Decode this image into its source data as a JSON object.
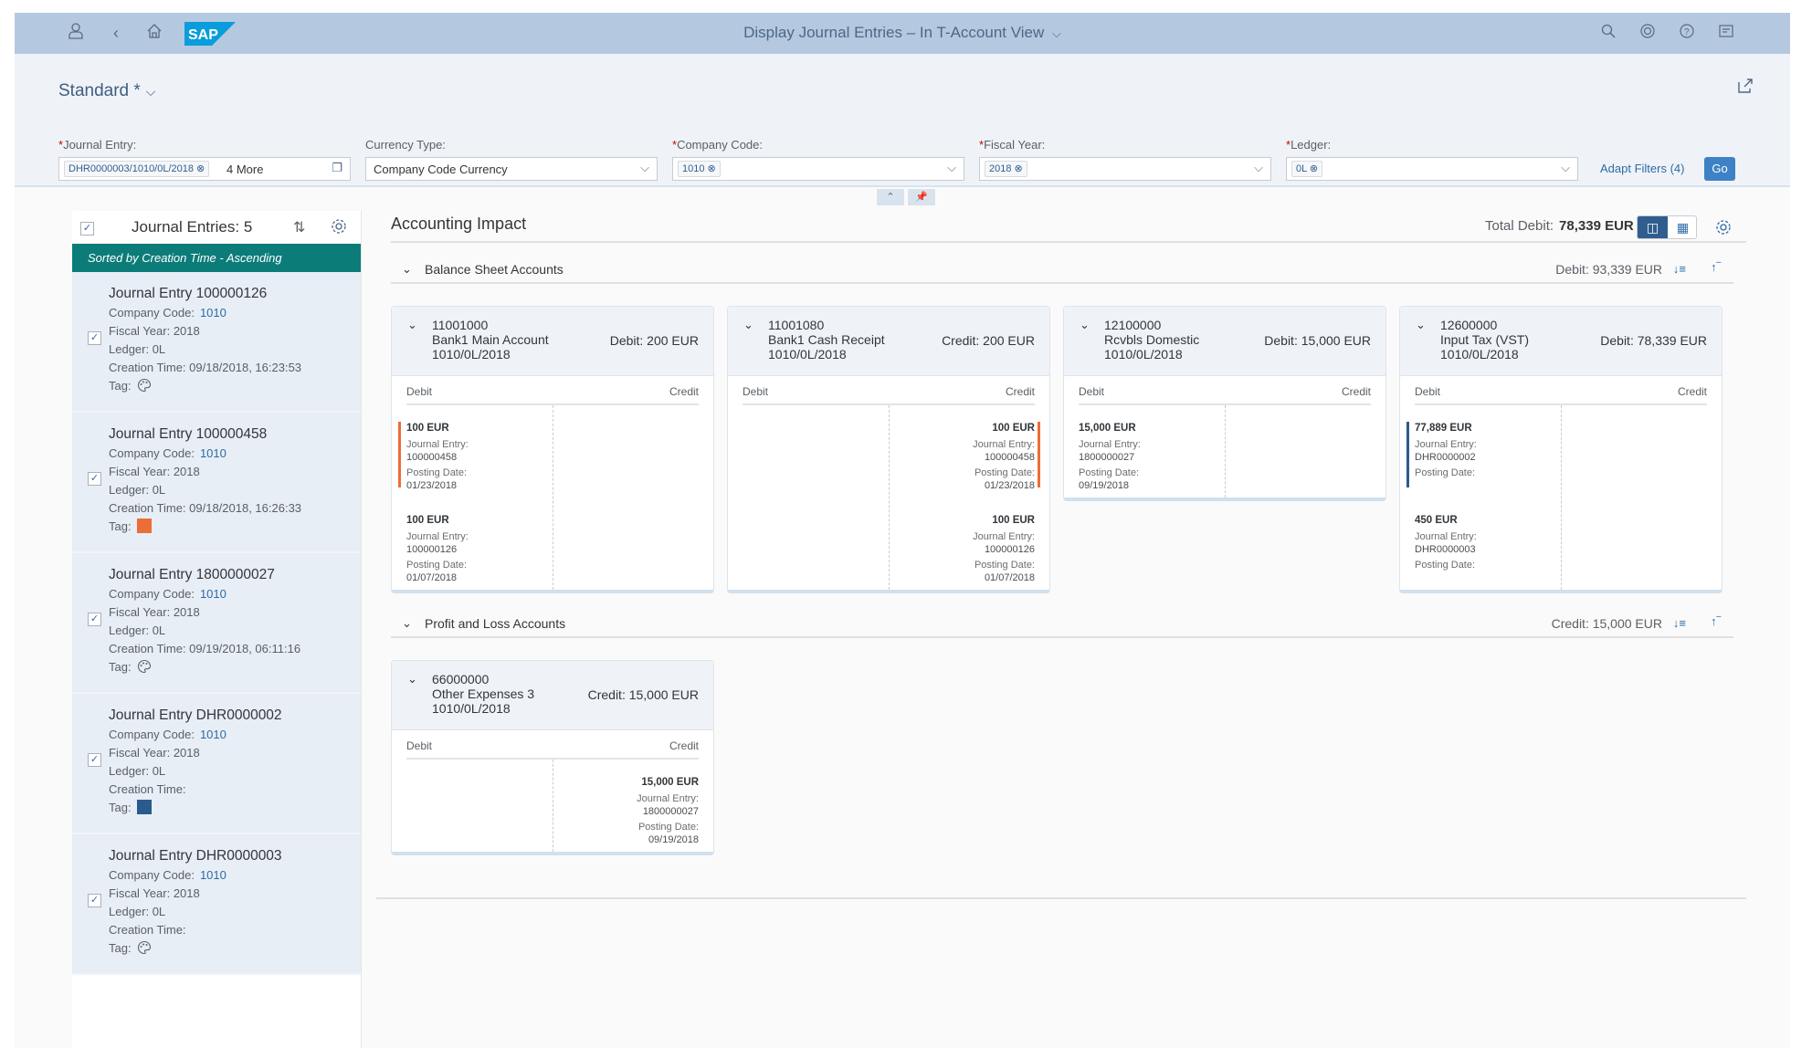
{
  "shell": {
    "title": "Display Journal Entries – In T-Account View",
    "title_chevron": "⌵",
    "logo_text": "SAP",
    "icons": [
      "user-icon",
      "back-icon",
      "home-icon",
      "search-icon",
      "copilot-icon",
      "help-icon",
      "notifications-icon"
    ],
    "brand_color": "#0a9ddb"
  },
  "header": {
    "variant": "Standard *",
    "variant_chevron": "⌵",
    "filters": {
      "journal_entry": {
        "label": "Journal Entry:",
        "required": "*",
        "token": "DHR0000003/1010/0L/2018 ⊗",
        "more": "4 More"
      },
      "currency_type": {
        "label": "Currency Type:",
        "value": "Company Code Currency"
      },
      "company_code": {
        "label": "Company Code:",
        "required": "*",
        "token": "1010 ⊗"
      },
      "fiscal_year": {
        "label": "Fiscal Year:",
        "required": "*",
        "token": "2018 ⊗"
      },
      "ledger": {
        "label": "Ledger:",
        "required": "*",
        "token": "0L ⊗"
      }
    },
    "adapt_filters": "Adapt Filters (4)",
    "go": "Go",
    "collapse_icon": "⌃",
    "pin_icon": "✎"
  },
  "left_panel": {
    "title": "Journal Entries: 5",
    "sort_icon": "⇅",
    "sorted_by": "Sorted by Creation Time - Ascending",
    "labels": {
      "company_code": "Company Code:",
      "fiscal_year": "Fiscal Year:",
      "ledger": "Ledger:",
      "creation_time": "Creation Time:",
      "tag": "Tag:"
    },
    "entries": [
      {
        "title": "Journal Entry 100000126",
        "company_code": "1010",
        "fiscal_year": "2018",
        "ledger": "0L",
        "creation_time": "09/18/2018, 16:23:53",
        "tag": "palette-icon",
        "checked": true
      },
      {
        "title": "Journal Entry 100000458",
        "company_code": "1010",
        "fiscal_year": "2018",
        "ledger": "0L",
        "creation_time": "09/18/2018, 16:26:33",
        "tag": "#ec6e37",
        "checked": true
      },
      {
        "title": "Journal Entry 1800000027",
        "company_code": "1010",
        "fiscal_year": "2018",
        "ledger": "0L",
        "creation_time": "09/19/2018, 06:11:16",
        "tag": "palette-icon",
        "checked": true
      },
      {
        "title": "Journal Entry DHR0000002",
        "company_code": "1010",
        "fiscal_year": "2018",
        "ledger": "0L",
        "creation_time": "",
        "tag": "#2a5b8e",
        "checked": true
      },
      {
        "title": "Journal Entry DHR0000003",
        "company_code": "1010",
        "fiscal_year": "2018",
        "ledger": "0L",
        "creation_time": "",
        "tag": "palette-icon",
        "checked": true
      }
    ]
  },
  "main": {
    "title": "Accounting Impact",
    "total_label": "Total Debit:",
    "total_value": "78,339 EUR",
    "labels": {
      "debit": "Debit",
      "credit": "Credit",
      "journal_entry": "Journal Entry:",
      "posting_date": "Posting Date:"
    },
    "sections": [
      {
        "name": "Balance Sheet Accounts",
        "summary": "Debit: 93,339 EUR",
        "accounts": [
          {
            "number": "11001000",
            "name": "Bank1 Main Account",
            "key": "1010/0L/2018",
            "amount": "Debit: 200 EUR",
            "items": [
              {
                "side": "debit",
                "amount": "100 EUR",
                "journal_entry": "100000458",
                "posting_date": "01/23/2018",
                "tag_color": "#ec6e37"
              },
              {
                "side": "debit",
                "amount": "100 EUR",
                "journal_entry": "100000126",
                "posting_date": "01/07/2018",
                "tag_color": ""
              }
            ]
          },
          {
            "number": "11001080",
            "name": "Bank1 Cash Receipt",
            "key": "1010/0L/2018",
            "amount": "Credit: 200 EUR",
            "items": [
              {
                "side": "credit",
                "amount": "100 EUR",
                "journal_entry": "100000458",
                "posting_date": "01/23/2018",
                "tag_color": "#ec6e37"
              },
              {
                "side": "credit",
                "amount": "100 EUR",
                "journal_entry": "100000126",
                "posting_date": "01/07/2018",
                "tag_color": ""
              }
            ]
          },
          {
            "number": "12100000",
            "name": "Rcvbls Domestic",
            "key": "1010/0L/2018",
            "amount": "Debit: 15,000 EUR",
            "items": [
              {
                "side": "debit",
                "amount": "15,000 EUR",
                "journal_entry": "1800000027",
                "posting_date": "09/19/2018",
                "tag_color": ""
              }
            ]
          },
          {
            "number": "12600000",
            "name": "Input Tax (VST)",
            "key": "1010/0L/2018",
            "amount": "Debit: 78,339 EUR",
            "items": [
              {
                "side": "debit",
                "amount": "77,889 EUR",
                "journal_entry": "DHR0000002",
                "posting_date": "",
                "tag_color": "#2a5b8e"
              },
              {
                "side": "debit",
                "amount": "450 EUR",
                "journal_entry": "DHR0000003",
                "posting_date": "",
                "tag_color": ""
              }
            ]
          }
        ]
      },
      {
        "name": "Profit and Loss Accounts",
        "summary": "Credit: 15,000 EUR",
        "accounts": [
          {
            "number": "66000000",
            "name": "Other Expenses 3",
            "key": "1010/0L/2018",
            "amount": "Credit: 15,000 EUR",
            "items": [
              {
                "side": "credit",
                "amount": "15,000 EUR",
                "journal_entry": "1800000027",
                "posting_date": "09/19/2018",
                "tag_color": ""
              }
            ]
          }
        ]
      }
    ]
  }
}
